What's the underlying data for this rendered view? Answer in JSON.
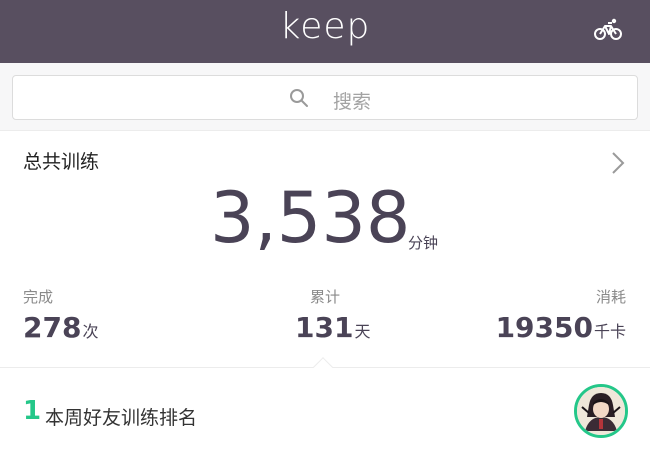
{
  "header": {
    "logo": "keep"
  },
  "search": {
    "placeholder": "搜索"
  },
  "stats": {
    "title": "总共训练",
    "total_value": "3,538",
    "total_unit": "分钟",
    "metrics": [
      {
        "label": "完成",
        "value": "278",
        "unit": "次"
      },
      {
        "label": "累计",
        "value": "131",
        "unit": "天"
      },
      {
        "label": "消耗",
        "value": "19350",
        "unit": "千卡"
      }
    ]
  },
  "ranking": {
    "rank": "1",
    "label": "本周好友训练排名"
  },
  "colors": {
    "header_bg": "#584f60",
    "accent_green": "#24c789",
    "value_text": "#4a4356"
  },
  "icons": [
    "bicycle-icon",
    "search-icon",
    "chevron-right-icon",
    "avatar"
  ]
}
